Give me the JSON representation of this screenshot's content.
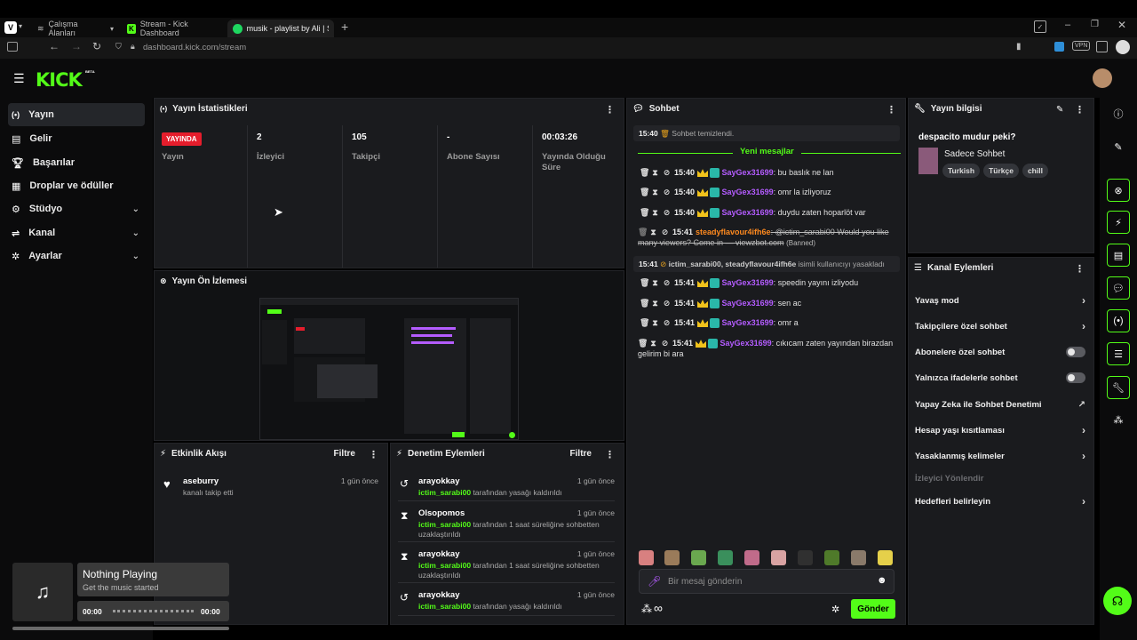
{
  "browser": {
    "tabs": [
      {
        "label": "Çalışma Alanları"
      },
      {
        "label": "Stream - Kick Dashboard"
      },
      {
        "label": "musik - playlist by Ali | Spo"
      }
    ],
    "url_domain": "dashboard.kick.com",
    "url_path": "/stream"
  },
  "header": {
    "logo": "KICK",
    "beta": "BETA"
  },
  "sidebar": {
    "items": [
      {
        "label": "Yayın",
        "icon": "broadcast-icon"
      },
      {
        "label": "Gelir",
        "icon": "revenue-icon"
      },
      {
        "label": "Başarılar",
        "icon": "trophy-icon"
      },
      {
        "label": "Droplar ve ödüller",
        "icon": "gift-icon"
      },
      {
        "label": "Stüdyo",
        "icon": "studio-icon"
      },
      {
        "label": "Kanal",
        "icon": "channel-icon"
      },
      {
        "label": "Ayarlar",
        "icon": "gear-icon"
      }
    ]
  },
  "stats": {
    "title": "Yayın İstatistikleri",
    "live_badge": "YAYINDA",
    "items": [
      {
        "value": "",
        "label": "Yayın"
      },
      {
        "value": "2",
        "label": "İzleyici"
      },
      {
        "value": "105",
        "label": "Takipçi"
      },
      {
        "value": "-",
        "label": "Abone Sayısı"
      },
      {
        "value": "00:03:26",
        "label": "Yayında Olduğu Süre"
      }
    ]
  },
  "preview": {
    "title": "Yayın Ön İzlemesi"
  },
  "activity": {
    "title": "Etkinlik Akışı",
    "filter": "Filtre",
    "events": [
      {
        "name": "aseburry",
        "ago": "1 gün önce",
        "desc": "kanalı takip etti"
      }
    ]
  },
  "moderation": {
    "title": "Denetim Eylemleri",
    "filter": "Filtre",
    "events": [
      {
        "name": "arayokkay",
        "ago": "1 gün önce",
        "mod": "ictim_sarabi00",
        "desc": " tarafından yasağı kaldırıldı"
      },
      {
        "name": "Olsopomos",
        "ago": "1 gün önce",
        "mod": "ictim_sarabi00",
        "desc": " tarafından 1 saat süreliğine sohbetten uzaklaştırıldı"
      },
      {
        "name": "arayokkay",
        "ago": "1 gün önce",
        "mod": "ictim_sarabi00",
        "desc": " tarafından 1 saat süreliğine sohbetten uzaklaştırıldı"
      },
      {
        "name": "arayokkay",
        "ago": "1 gün önce",
        "mod": "ictim_sarabi00",
        "desc": " tarafından yasağı kaldırıldı"
      }
    ]
  },
  "chat": {
    "title": "Sohbet",
    "cleared_time": "15:40",
    "cleared_text": "Sohbet temizlendi.",
    "new_messages": "Yeni mesajlar",
    "messages": [
      {
        "time": "15:40",
        "user": "SayGex31699",
        "text": ": bu baslık ne lan"
      },
      {
        "time": "15:40",
        "user": "SayGex31699",
        "text": ": omr la izliyoruz"
      },
      {
        "time": "15:40",
        "user": "SayGex31699",
        "text": ": duydu zaten hoparlöt var"
      },
      {
        "time": "15:41",
        "user": "steadyflavour4ifh6e",
        "text": ": @ictim_sarabi00 Would you like many viewers? Come in — viewzbot.com",
        "banned": "(Banned)"
      },
      {
        "time": "15:41",
        "user": "SayGex31699",
        "text": ": speedin yayını izliyodu"
      },
      {
        "time": "15:41",
        "user": "SayGex31699",
        "text": ": sen ac"
      },
      {
        "time": "15:41",
        "user": "SayGex31699",
        "text": ": omr a"
      },
      {
        "time": "15:41",
        "user": "SayGex31699",
        "text": ": cıkıcam zaten yayından birazdan gelirim bi ara"
      }
    ],
    "ban_notice": {
      "time": "15:41",
      "who": "ictim_sarabi00, steadyflavour4ifh6e",
      "text": " isimli kullanıcıyı yasakladı"
    },
    "input_placeholder": "Bir mesaj gönderin",
    "send": "Gönder",
    "infinity": "∞"
  },
  "stream_info": {
    "title": "Yayın bilgisi",
    "stream_title": "despacito mudur peki?",
    "category": "Sadece Sohbet",
    "tags": [
      "Turkish",
      "Türkçe",
      "chill"
    ]
  },
  "channel_actions": {
    "title": "Kanal Eylemleri",
    "items": [
      {
        "label": "Yavaş mod",
        "control": "arrow"
      },
      {
        "label": "Takipçilere özel sohbet",
        "control": "arrow"
      },
      {
        "label": "Abonelere özel sohbet",
        "control": "toggle"
      },
      {
        "label": "Yalnızca ifadelerle sohbet",
        "control": "toggle"
      },
      {
        "label": "Yapay Zeka ile Sohbet Denetimi",
        "control": "external"
      },
      {
        "label": "Hesap yaşı kısıtlaması",
        "control": "arrow"
      },
      {
        "label": "Yasaklanmış kelimeler",
        "control": "arrow"
      }
    ],
    "section": "İzleyici Yönlendir",
    "targets": "Hedefleri belirleyin"
  },
  "player": {
    "title": "Nothing Playing",
    "subtitle": "Get the music started",
    "time_start": "00:00",
    "time_end": "00:00"
  }
}
